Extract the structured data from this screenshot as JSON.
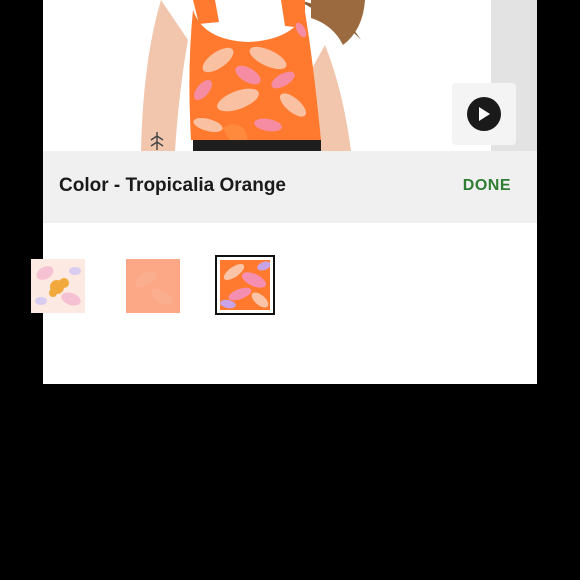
{
  "color_selector": {
    "label": "Color - Tropicalia Orange",
    "done_label": "DONE"
  },
  "swatches": [
    {
      "name": "tropical floral white",
      "selected": false
    },
    {
      "name": "solid peach",
      "selected": false
    },
    {
      "name": "Tropicalia Orange",
      "selected": true
    }
  ],
  "colors": {
    "done_green": "#2e7d32",
    "top_orange": "#ff7a2e",
    "leaf_pink": "#f48fb1"
  }
}
